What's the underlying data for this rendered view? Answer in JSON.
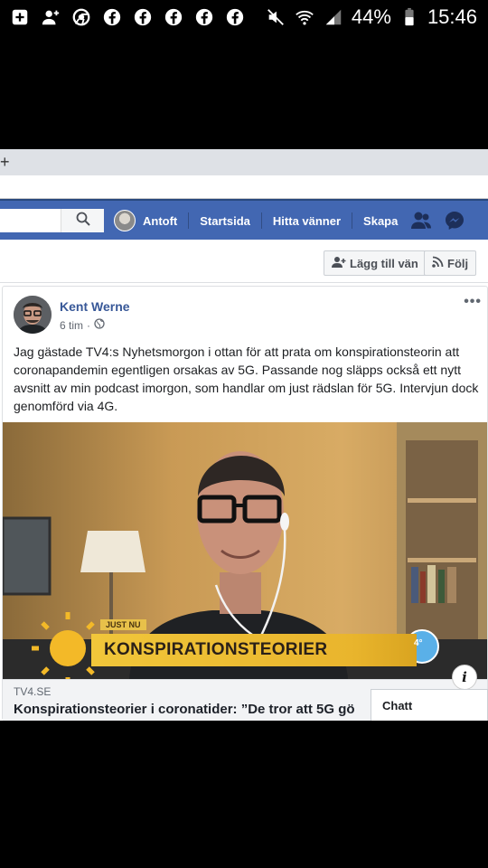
{
  "status_bar": {
    "battery": "44%",
    "time": "15:46",
    "left_icons": [
      "plus-box-icon",
      "add-person-icon",
      "chrome-icon",
      "facebook-icon",
      "facebook-icon",
      "facebook-icon",
      "facebook-icon",
      "facebook-icon"
    ],
    "right_icons": [
      "mute-icon",
      "wifi-icon",
      "signal-icon",
      "battery-icon"
    ]
  },
  "browser": {
    "new_tab": "+"
  },
  "fb_nav": {
    "user": "Antoft",
    "home": "Startsida",
    "find_friends": "Hitta vänner",
    "create": "Skapa",
    "color": "#4267b2"
  },
  "profile_actions": {
    "add_friend": "Lägg till vän",
    "follow": "Följ"
  },
  "post": {
    "author": "Kent Werne",
    "time": "6 tim",
    "separator": "·",
    "more": "•••",
    "text": "Jag gästade TV4:s Nyhetsmorgon i ottan för att prata om konspirationsteorin att coronapandemin egentligen orsakas av 5G. Passande nog släpps också ett nytt avsnitt av min podcast imorgon, som handlar om just rädslan för 5G. Intervjun dock genomförd via 4G.",
    "image": {
      "banner_small": "JUST NU",
      "banner_main": "KONSPIRATIONSTEORIER",
      "weather": "4°"
    },
    "link": {
      "domain": "TV4.SE",
      "title": "Konspirationsteorier i coronatider: ”De tror att 5G gö"
    }
  },
  "chat": {
    "label": "Chatt"
  },
  "info_button": "i"
}
